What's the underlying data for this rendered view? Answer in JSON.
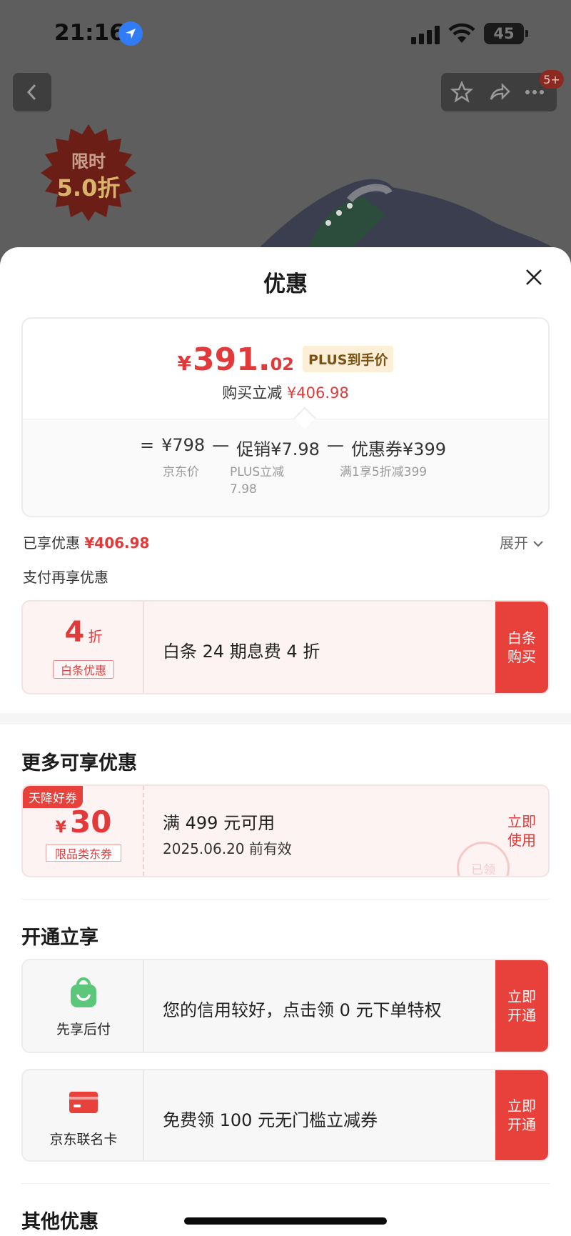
{
  "status_bar": {
    "time": "21:16",
    "battery": "45"
  },
  "nav": {
    "badge": "5+"
  },
  "promo": {
    "line1": "限时",
    "line2": "5.0折"
  },
  "sheet": {
    "title": "优惠"
  },
  "price_card": {
    "yen": "¥",
    "price_int": "391.",
    "price_dec": "02",
    "plus_tag": "PLUS到手价",
    "reduce_label": "购买立减",
    "reduce_amount": "¥406.98",
    "formula": {
      "eq": "=",
      "jd_price": "¥798",
      "minus1": "—",
      "promo": "促销¥7.98",
      "minus2": "—",
      "coupon": "优惠券¥399"
    },
    "sub": {
      "jd_label": "京东价",
      "plus_line1": "PLUS立减",
      "plus_line2": "7.98",
      "coupon_label": "满1享5折减399"
    }
  },
  "enjoyed": {
    "label": "已享优惠",
    "amount": "¥406.98",
    "expand": "展开"
  },
  "pay_more": {
    "title": "支付再享优惠"
  },
  "baitiao_card": {
    "num": "4",
    "unit": "折",
    "tag": "白条优惠",
    "text": "白条 24 期息费 4 折",
    "action_l1": "白条",
    "action_l2": "购买"
  },
  "more": {
    "title": "更多可享优惠",
    "coupon": {
      "ribbon": "天降好券",
      "yen": "¥",
      "amount": "30",
      "tag": "限品类东券",
      "line1": "满 499 元可用",
      "line2": "2025.06.20 前有效",
      "action_l1": "立即",
      "action_l2": "使用",
      "stamp": "已领"
    }
  },
  "open": {
    "title": "开通立享",
    "items": [
      {
        "label": "先享后付",
        "text": "您的信用较好，点击领 0 元下单特权",
        "action_l1": "立即",
        "action_l2": "开通"
      },
      {
        "label": "京东联名卡",
        "text": "免费领 100 元无门槛立减券",
        "action_l1": "立即",
        "action_l2": "开通"
      }
    ]
  },
  "other": {
    "title": "其他优惠"
  },
  "colors": {
    "accent": "#e8403a",
    "price_red": "#e23a3a",
    "plus_gold": "#fbefd7",
    "pay_green": "#5cc67a"
  }
}
